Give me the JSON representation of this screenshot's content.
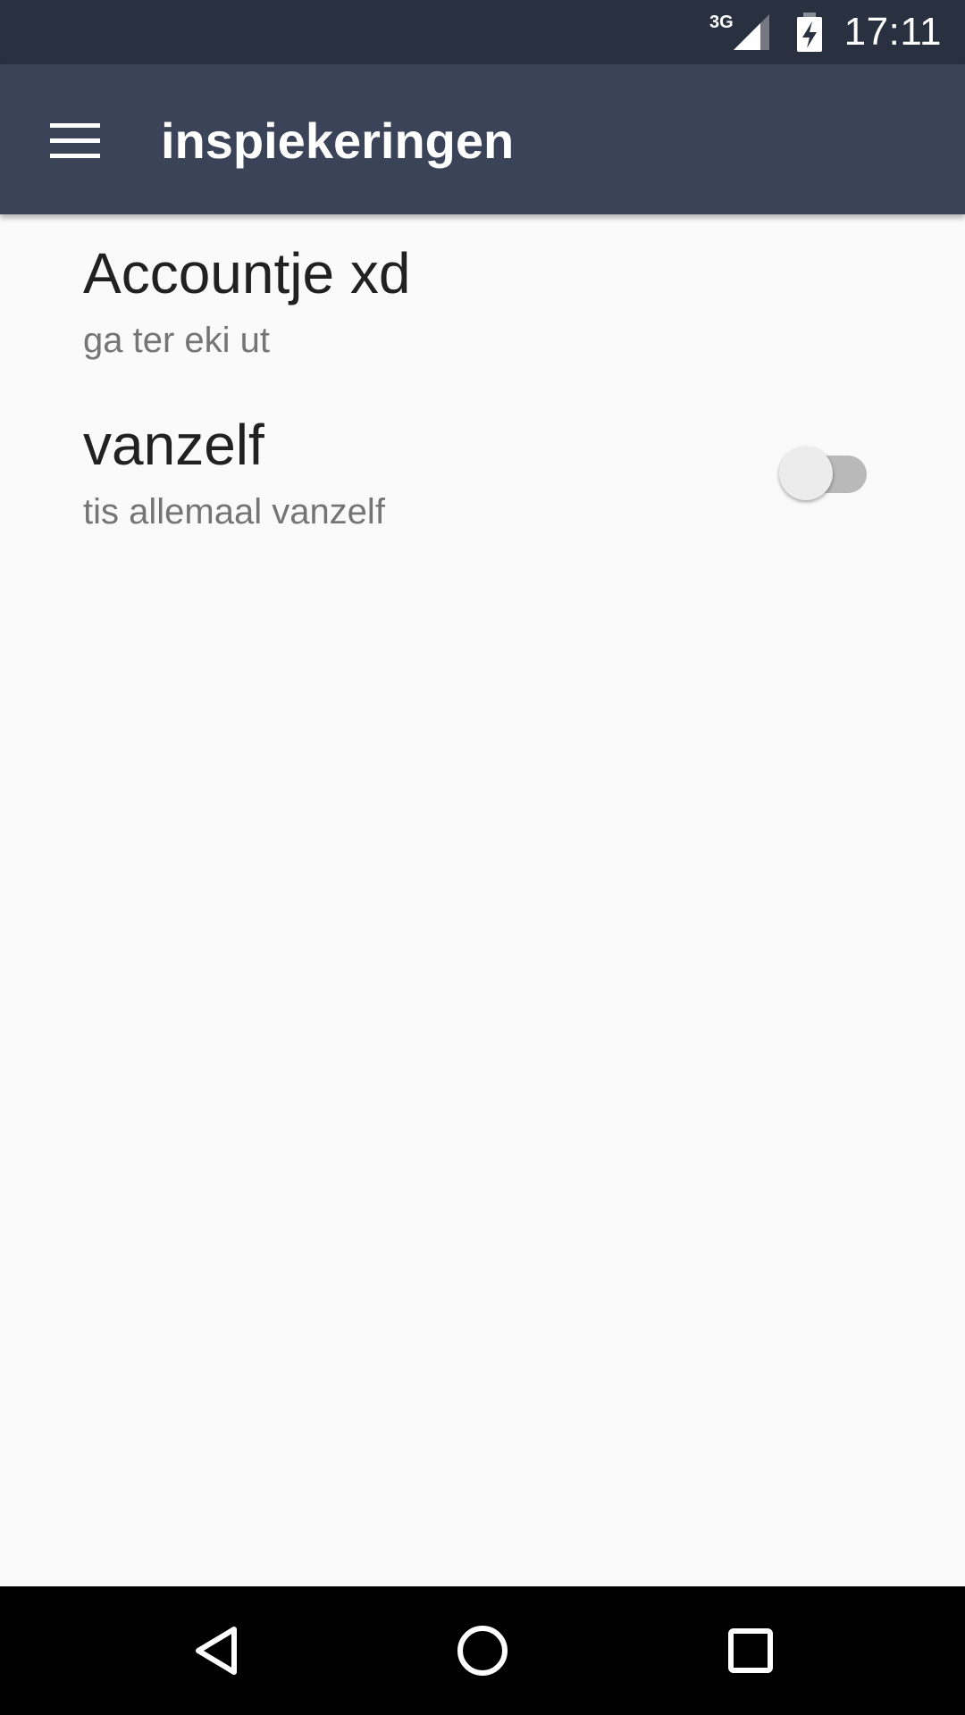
{
  "status_bar": {
    "network_label": "3G",
    "time": "17:11",
    "icons": [
      "signal-icon",
      "battery-charging-icon"
    ]
  },
  "app_bar": {
    "title": "inspiekeringen",
    "menu_icon": "hamburger-menu-icon"
  },
  "preferences": [
    {
      "title": "Accountje xd",
      "summary": "ga ter eki ut"
    },
    {
      "title": "vanzelf",
      "summary": "tis allemaal vanzelf",
      "switch_on": false
    }
  ],
  "nav_bar": {
    "icons": [
      "back-icon",
      "home-icon",
      "recents-icon"
    ]
  },
  "colors": {
    "status_bar": "#29303f",
    "app_bar": "#3b4358",
    "background": "#fafafa",
    "title_text": "#212121",
    "summary_text": "#757575",
    "switch_track_off": "#b9b9b9",
    "switch_thumb_off": "#ececec"
  }
}
